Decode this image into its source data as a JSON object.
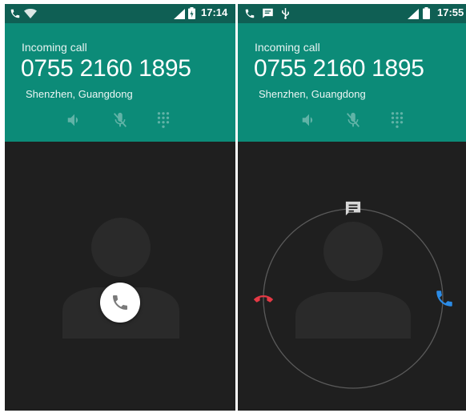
{
  "screens": [
    {
      "status_time": "17:14",
      "incoming_label": "Incoming call",
      "phone_number": "0755 2160 1895",
      "location": "Shenzhen, Guangdong",
      "controls": [
        "speaker-icon",
        "mute-mic-icon",
        "dialpad-icon"
      ],
      "answer_handle": "phone-icon"
    },
    {
      "status_time": "17:55",
      "incoming_label": "Incoming call",
      "phone_number": "0755 2160 1895",
      "location": "Shenzhen, Guangdong",
      "controls": [
        "speaker-icon",
        "mute-mic-icon",
        "dialpad-icon"
      ],
      "targets": [
        "message-icon",
        "decline-icon",
        "answer-icon"
      ]
    }
  ],
  "colors": {
    "statusbar": "#0f5f54",
    "header": "#0c8b78",
    "background": "#1f1f1f",
    "decline": "#e53945",
    "answer": "#2b8be6"
  }
}
